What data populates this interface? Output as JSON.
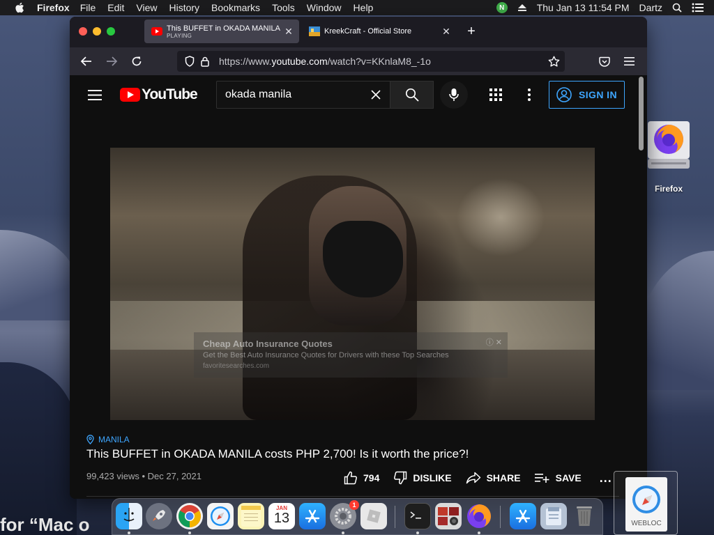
{
  "menubar": {
    "app_name": "Firefox",
    "items": [
      "File",
      "Edit",
      "View",
      "History",
      "Bookmarks",
      "Tools",
      "Window",
      "Help"
    ],
    "extension_badge": "N",
    "clock": "Thu Jan 13  11:54 PM",
    "user": "Dartz"
  },
  "tabs": [
    {
      "title": "This BUFFET in OKADA MANILA costs PHP 2,700! Is it worth the price?!",
      "status": "PLAYING"
    },
    {
      "title": "KreekCraft - Official Store",
      "status": ""
    }
  ],
  "navbar": {
    "url_prefix": "https://www.",
    "url_domain": "youtube.com",
    "url_path": "/watch?v=KKnlaM8_-1o"
  },
  "youtube": {
    "logo_text": "YouTube",
    "search_query": "okada manila",
    "sign_in_label": "SIGN IN"
  },
  "ad": {
    "title": "Cheap Auto Insurance Quotes",
    "description": "Get the Best Auto Insurance Quotes for Drivers with these Top Searches",
    "url": "favoritesearches.com",
    "close": "ⓘ ✕"
  },
  "video": {
    "location": "MANILA",
    "title": "This BUFFET in OKADA MANILA costs PHP 2,700! Is it worth the price?!",
    "meta": "99,423 views • Dec 27, 2021",
    "likes": "794",
    "dislike_label": "DISLIKE",
    "share_label": "SHARE",
    "save_label": "SAVE",
    "more": "..."
  },
  "desktop": {
    "icon_label": "Firefox",
    "partial_text": "for “Mac o",
    "webloc_label": "WEBLOC"
  },
  "dock": {
    "calendar_month": "JAN",
    "calendar_day": "13",
    "settings_badge": "1"
  },
  "colors": {
    "accent": "#3ea6ff",
    "youtube_red": "#ff0000",
    "background": "#0f0f0f"
  }
}
